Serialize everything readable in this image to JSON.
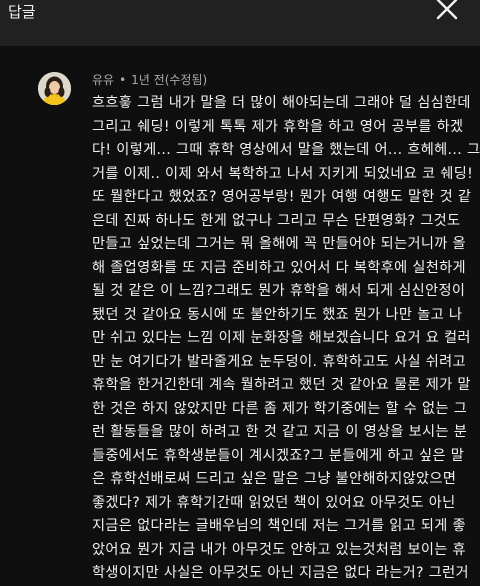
{
  "header": {
    "title": "답글",
    "close_icon": "close-icon"
  },
  "comment": {
    "author": "유유",
    "separator": "•",
    "time": "1년 전(수정됨)",
    "lines": [
      "흐흐흫 그럼 내가 말을 더 많이 해야되는데 그래야 덜 심심한데",
      "그리고 쉐딩! 이렇게 톡톡 제가 휴학을 하고 영어 공부를 하겠",
      "다! 이렇게... 그때 휴학 영상에서 말을 했는데 어... 흐헤헤... 그",
      "거를 이제.. 이제 와서 복학하고 나서 지키게 되었네요 코 쉐딩!",
      "또 뭘한다고 했었죠? 영어공부랑! 뭔가 여행 여행도 말한 것 같",
      "은데 진짜 하나도 한게 없구나 그리고 무슨 단편영화? 그것도",
      "만들고 싶었는데 그거는 뭐 올해에 꼭 만들어야 되는거니까 올",
      "해 졸업영화를 또 지금 준비하고 있어서 다 복학후에 실천하게",
      "될 것 같은 이 느낌?그래도 뭔가 휴학을 해서 되게 심신안정이",
      "됐던 것 같아요 동시에 또 불안하기도 했죠 뭔가 나만 놀고 나",
      "만 쉬고 있다는 느낌 이제 눈화장을 해보겠습니다 요거 요 컬러",
      "만 눈 여기다가 발라줄게요 눈두덩이. 휴학하고도 사실 쉬려고",
      "휴학을 한거긴한데 계속 뭘하려고 했던 것 같아요 물론 제가 말",
      "한 것은 하지 않았지만 다른 좀 제가 학기중에는 할 수 없는 그",
      "런 활동들을 많이 하려고 한 것 같고 지금 이 영상을 보시는 분",
      "들중에서도 휴학생분들이 계시겠죠?그 분들에게 하고 싶은 말",
      "은 휴학선배로써 드리고 싶은 말은 그냥 불안해하지않았으면",
      "좋겠다? 제가 휴학기간때 읽었던 책이 있어요 아무것도 아닌",
      "지금은 없다라는 글배우님의 책인데 저는 그거를 읽고 되게 좋",
      "았어요 뭔가 지금 내가 아무것도 안하고 있는것처럼 보이는 휴",
      "학생이지만 사실은 아무것도 아닌 지금은 없다 라는거? 그런거"
    ]
  }
}
